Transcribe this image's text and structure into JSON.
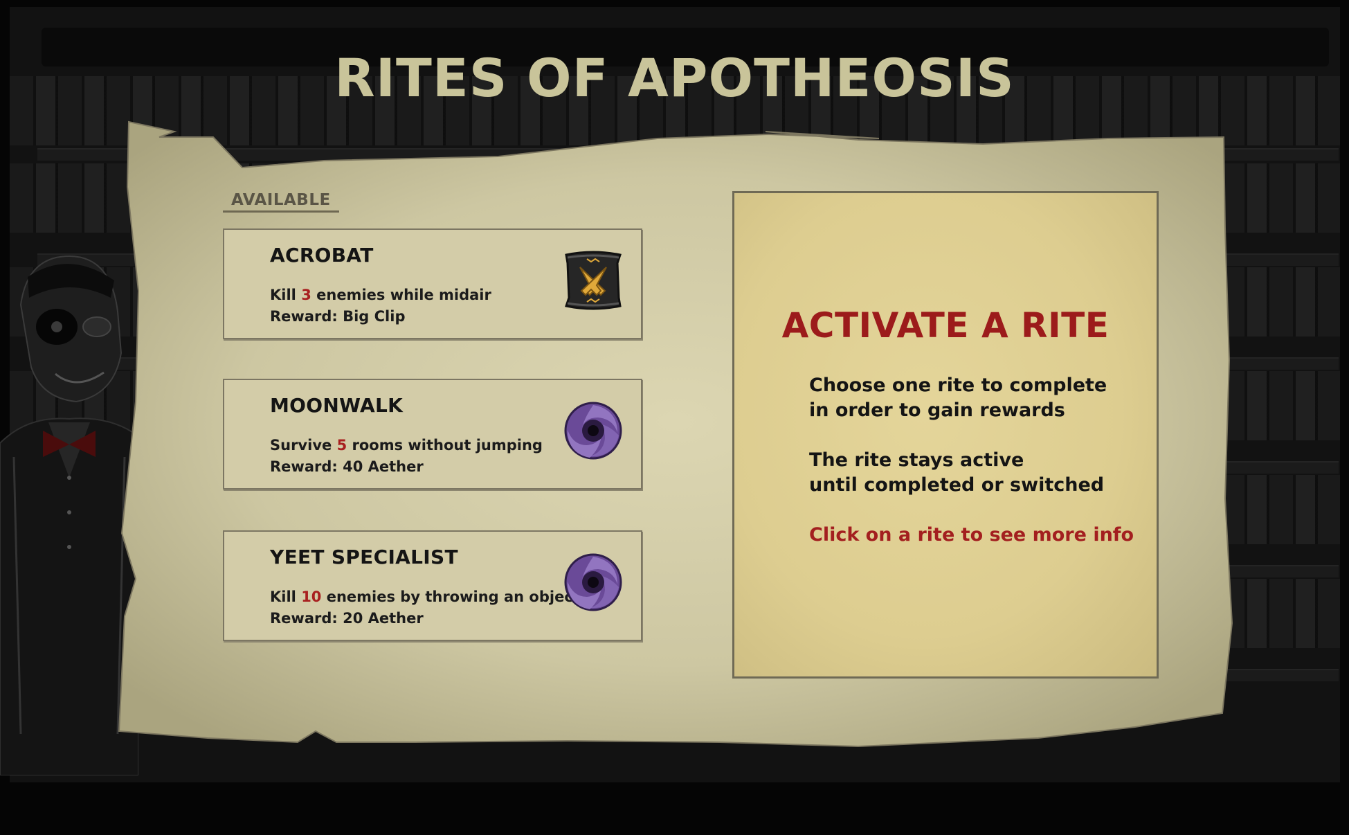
{
  "title": "RITES OF APOTHEOSIS",
  "section_label": "AVAILABLE",
  "rites": [
    {
      "name": "ACROBAT",
      "desc_before": "Kill ",
      "desc_value": "3",
      "desc_after": " enemies while midair",
      "reward": "Reward: Big Clip",
      "icon": "crossed-pistols-scroll-icon"
    },
    {
      "name": "MOONWALK",
      "desc_before": "Survive ",
      "desc_value": "5",
      "desc_after": " rooms without jumping",
      "reward": "Reward: 40 Aether",
      "icon": "purple-vortex-icon"
    },
    {
      "name": "YEET SPECIALIST",
      "desc_before": "Kill ",
      "desc_value": "10",
      "desc_after": " enemies by throwing an object",
      "reward": "Reward: 20 Aether",
      "icon": "purple-vortex-icon"
    }
  ],
  "info": {
    "title": "ACTIVATE A RITE",
    "line1": "Choose one rite to complete",
    "line2": "in order to gain rewards",
    "line3": "The rite stays active",
    "line4": "until completed or switched",
    "click_hint": "Click on a rite to see more info"
  },
  "colors": {
    "title": "#c9c49a",
    "parchment": "#cfc9a4",
    "card": "#d3cca8",
    "panel": "#ddcd90",
    "highlight_red": "#a81f1f"
  }
}
